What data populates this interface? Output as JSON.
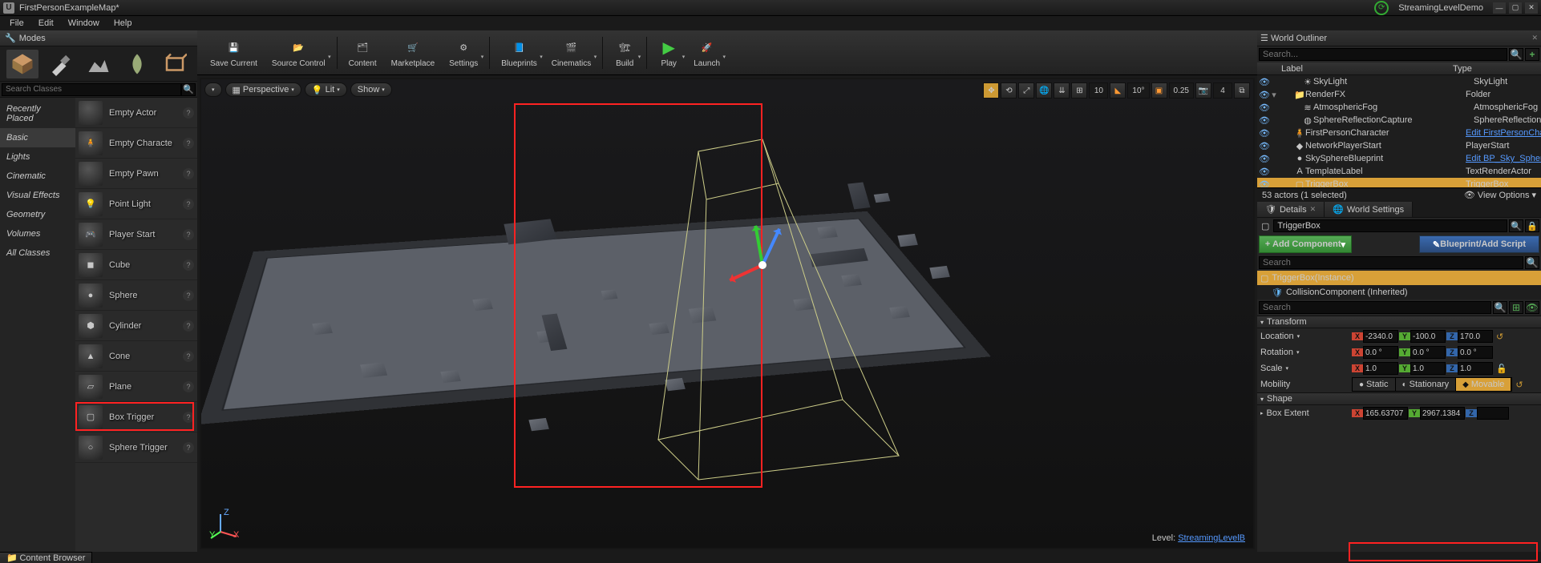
{
  "title": "FirstPersonExampleMap*",
  "streaming_demo": "StreamingLevelDemo",
  "menubar": [
    "File",
    "Edit",
    "Window",
    "Help"
  ],
  "modes": {
    "tab": "Modes",
    "search_placeholder": "Search Classes"
  },
  "categories": [
    "Recently Placed",
    "Basic",
    "Lights",
    "Cinematic",
    "Visual Effects",
    "Geometry",
    "Volumes",
    "All Classes"
  ],
  "actors": [
    "Empty Actor",
    "Empty Characte",
    "Empty Pawn",
    "Point Light",
    "Player Start",
    "Cube",
    "Sphere",
    "Cylinder",
    "Cone",
    "Plane",
    "Box Trigger",
    "Sphere Trigger"
  ],
  "toolbar": {
    "save": "Save Current",
    "source": "Source Control",
    "content": "Content",
    "market": "Marketplace",
    "settings": "Settings",
    "blueprints": "Blueprints",
    "cinematics": "Cinematics",
    "build": "Build",
    "play": "Play",
    "launch": "Launch"
  },
  "viewport": {
    "perspective": "Perspective",
    "lit": "Lit",
    "show": "Show",
    "grid_snap": "10",
    "angle_snap": "10°",
    "scale_snap": "0.25",
    "cam_speed": "4",
    "level_prefix": "Level:  ",
    "level_name": "StreamingLevelB"
  },
  "outliner": {
    "tab": "World Outliner",
    "search_placeholder": "Search...",
    "h_label": "Label",
    "h_type": "Type",
    "rows": [
      {
        "ind": 3,
        "ico": "☀",
        "label": "SkyLight",
        "type": "SkyLight"
      },
      {
        "ind": 2,
        "ico": "📁",
        "label": "RenderFX",
        "type": "Folder",
        "exp": true
      },
      {
        "ind": 3,
        "ico": "≋",
        "label": "AtmosphericFog",
        "type": "AtmosphericFog"
      },
      {
        "ind": 3,
        "ico": "◍",
        "label": "SphereReflectionCapture",
        "type": "SphereReflectionCap"
      },
      {
        "ind": 2,
        "ico": "🧍",
        "label": "FirstPersonCharacter",
        "type": "Edit FirstPersonCha",
        "link": true
      },
      {
        "ind": 2,
        "ico": "◆",
        "label": "NetworkPlayerStart",
        "type": "PlayerStart"
      },
      {
        "ind": 2,
        "ico": "●",
        "label": "SkySphereBlueprint",
        "type": "Edit BP_Sky_Sphere",
        "link": true
      },
      {
        "ind": 2,
        "ico": "A",
        "label": "TemplateLabel",
        "type": "TextRenderActor"
      },
      {
        "ind": 2,
        "ico": "▢",
        "label": "TriggerBox",
        "type": "TriggerBox",
        "sel": true
      }
    ],
    "footer": "53 actors (1 selected)",
    "view_options": "View Options"
  },
  "details": {
    "tab_details": "Details",
    "tab_world": "World Settings",
    "actor_name": "TriggerBox",
    "add": "+ Add Component",
    "blueprint": "Blueprint/Add Script",
    "search_placeholder": "Search",
    "components": [
      {
        "label": "TriggerBox(Instance)",
        "sel": true
      },
      {
        "label": "CollisionComponent (Inherited)"
      }
    ],
    "transform": {
      "hdr": "Transform",
      "location": {
        "label": "Location",
        "x": "-2340.0",
        "y": "-100.0",
        "z": "170.0"
      },
      "rotation": {
        "label": "Rotation",
        "x": "0.0 °",
        "y": "0.0 °",
        "z": "0.0 °"
      },
      "scale": {
        "label": "Scale",
        "x": "1.0",
        "y": "1.0",
        "z": "1.0"
      },
      "mobility": {
        "label": "Mobility",
        "static": "Static",
        "stationary": "Stationary",
        "movable": "Movable"
      }
    },
    "shape": {
      "hdr": "Shape",
      "extent_label": "Box Extent",
      "x": "165.63707",
      "y": "2967.1384",
      "z": ""
    }
  },
  "content_browser": "Content Browser"
}
